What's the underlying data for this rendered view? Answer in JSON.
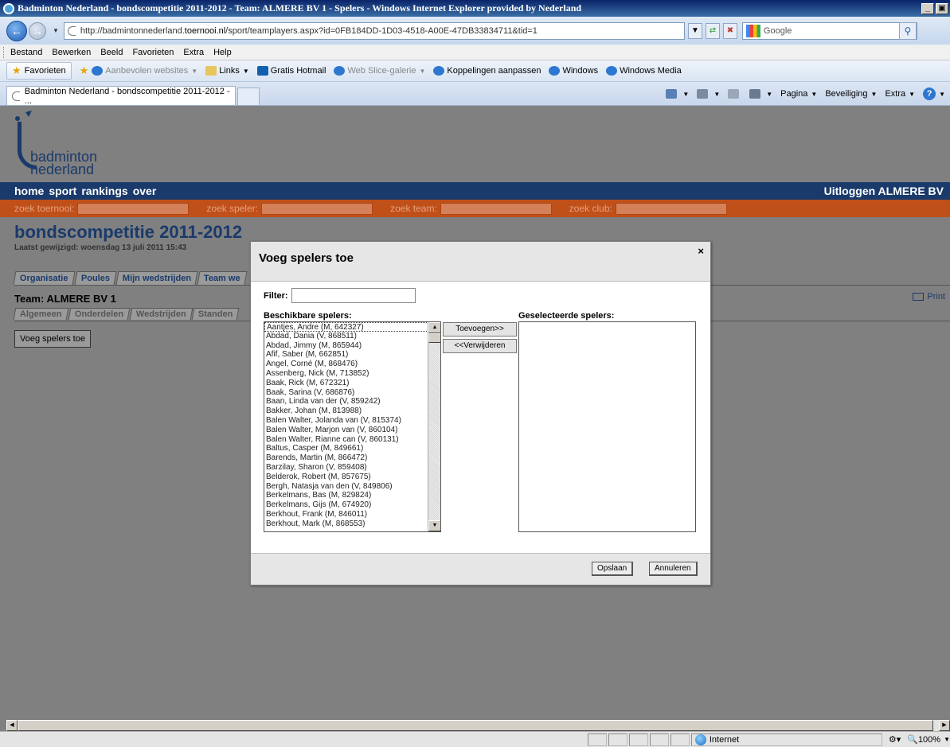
{
  "window": {
    "title": "Badminton Nederland - bondscompetitie 2011-2012 - Team: ALMERE BV 1 - Spelers - Windows Internet Explorer provided by Nederland",
    "min_glyph": "_",
    "max_glyph": "▣"
  },
  "address": {
    "url_prefix": "http://badmintonnederland.",
    "url_domain": "toernooi.nl",
    "url_path": "/sport/teamplayers.aspx?id=0FB184DD-1D03-4518-A00E-47DB33834711&tid=1",
    "search_placeholder": "Google"
  },
  "menu": [
    "Bestand",
    "Bewerken",
    "Beeld",
    "Favorieten",
    "Extra",
    "Help"
  ],
  "favorites": {
    "button": "Favorieten",
    "items": [
      {
        "label": "Aanbevolen websites",
        "caret": true,
        "icon": "ie",
        "gray": true
      },
      {
        "label": "Links",
        "caret": true,
        "icon": "folder",
        "gray": false
      },
      {
        "label": "Gratis Hotmail",
        "caret": false,
        "icon": "hot",
        "gray": false
      },
      {
        "label": "Web Slice-galerie",
        "caret": true,
        "icon": "ie",
        "gray": true
      },
      {
        "label": "Koppelingen aanpassen",
        "caret": false,
        "icon": "ie",
        "gray": false
      },
      {
        "label": "Windows",
        "caret": false,
        "icon": "ie",
        "gray": false
      },
      {
        "label": "Windows Media",
        "caret": false,
        "icon": "ie",
        "gray": false
      }
    ]
  },
  "tab": {
    "label": "Badminton Nederland - bondscompetitie 2011-2012 - ..."
  },
  "commands": [
    "Pagina",
    "Beveiliging",
    "Extra"
  ],
  "site": {
    "logo_line1": "badminton",
    "logo_line2": "nederland",
    "nav": [
      "home",
      "sport",
      "rankings",
      "over"
    ],
    "logout": "Uitloggen ALMERE BV",
    "search_labels": [
      "zoek toernooi:",
      "zoek speler:",
      "zoek team:",
      "zoek club:"
    ],
    "page_title": "bondscompetitie 2011-2012",
    "last_modified": "Laatst gewijzigd: woensdag 13 juli 2011 15:43",
    "tabs": [
      "Organisatie",
      "Poules",
      "Mijn wedstrijden",
      "Team we"
    ],
    "team_header": "Team: ALMERE BV 1",
    "print": "Print",
    "subtabs": [
      "Algemeen",
      "Onderdelen",
      "Wedstrijden",
      "Standen"
    ],
    "add_players_button": "Voeg spelers toe"
  },
  "dialog": {
    "title": "Voeg spelers toe",
    "close": "×",
    "filter_label": "Filter:",
    "filter_value": "",
    "available_label": "Beschikbare spelers:",
    "selected_label": "Geselecteerde spelers:",
    "add_button": "Toevoegen>>",
    "remove_button": "<<Verwijderen",
    "save_button": "Opslaan",
    "cancel_button": "Annuleren",
    "available_players": [
      "Aantjes, Andre (M, 642327)",
      "Abdad, Dania (V, 868511)",
      "Abdad, Jimmy (M, 865944)",
      "Afif, Saber (M, 662851)",
      "Angel, Corné (M, 868476)",
      "Assenberg, Nick (M, 713852)",
      "Baak, Rick (M, 672321)",
      "Baak, Sarina (V, 686876)",
      "Baan, Linda van der (V, 859242)",
      "Bakker, Johan (M, 813988)",
      "Balen Walter, Jolanda van (V, 815374)",
      "Balen Walter, Marjon van (V, 860104)",
      "Balen Walter, Rianne can (V, 860131)",
      "Baltus, Casper (M, 849661)",
      "Barends, Martin (M, 866472)",
      "Barzilay, Sharon (V, 859408)",
      "Belderok, Robert (M, 857675)",
      "Bergh, Natasja van den (V, 849806)",
      "Berkelmans, Bas (M, 829824)",
      "Berkelmans, Gijs (M, 674920)",
      "Berkhout, Frank (M, 846011)",
      "Berkhout, Mark (M, 868553)"
    ]
  },
  "status": {
    "zone": "Internet",
    "zoom": "100%"
  }
}
